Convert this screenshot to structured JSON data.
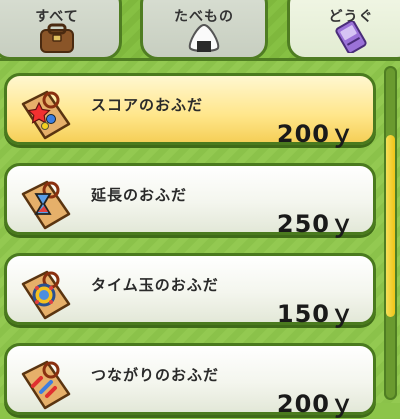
{
  "tabs": [
    {
      "label": "すべて",
      "icon": "bag-icon"
    },
    {
      "label": "たべもの",
      "icon": "onigiri-icon"
    },
    {
      "label": "どうぐ",
      "icon": "ticket-icon"
    }
  ],
  "active_tab": 2,
  "items": [
    {
      "name": "スコアのおふだ",
      "price": "200ｙ",
      "icon": "score-charm-icon",
      "selected": true
    },
    {
      "name": "延長のおふだ",
      "price": "250ｙ",
      "icon": "extend-charm-icon",
      "selected": false
    },
    {
      "name": "タイム玉のおふだ",
      "price": "150ｙ",
      "icon": "time-orb-charm-icon",
      "selected": false
    },
    {
      "name": "つながりのおふだ",
      "price": "200ｙ",
      "icon": "link-charm-icon",
      "selected": false
    }
  ],
  "scrollbar": {
    "position": 0.45,
    "visible_fraction": 0.55
  },
  "colors": {
    "background": "#8cc44a",
    "border": "#4a7a1e",
    "selected": "#ffe68a",
    "scroll_thumb": "#f0c418"
  }
}
